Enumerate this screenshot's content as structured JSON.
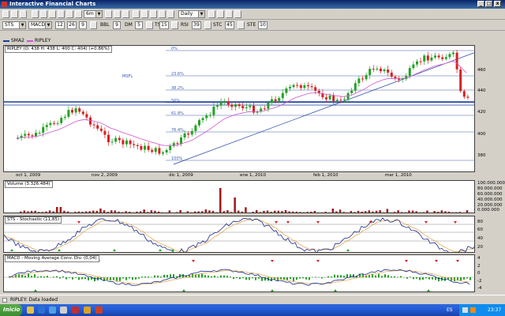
{
  "app": {
    "title": "Interactive Financial Charts",
    "status": "RIPLEY: Data loaded"
  },
  "toolbar1": {
    "period_value": "6m",
    "freq_value": "Daily",
    "buttons": [
      "▭",
      "▭",
      "▭",
      "▭",
      "▭",
      "▭",
      "▭",
      "▭",
      "▭",
      "▭",
      "▭",
      "▭",
      "▭",
      "▭",
      "▭",
      "▭",
      "▭",
      "▭",
      "▭",
      "▭"
    ]
  },
  "toolbar2": {
    "symbol": "STS",
    "indicator": "MACD",
    "fields": [
      "12",
      "26",
      "9"
    ],
    "lbl_bbl": "BBL",
    "val_bbl": "9",
    "lbl_dm": "DM",
    "val_dm": "5",
    "lbl_tsi": "TSI",
    "val_tsi": "15",
    "lbl_rsi": "RSI",
    "val_rsi": "39",
    "lbl_stc": "STC",
    "val_stc": "45",
    "lbl_x": "STE",
    "val_x": "10"
  },
  "legend": {
    "sma": "SMA2",
    "ripley": "RIPLEY",
    "quote": "RIPLEY (O: 438  H: 438  L: 400  C: 404) (+0.86%)"
  },
  "main": {
    "fib_labels": [
      "0%",
      "23.6%",
      "38.2%",
      "50%",
      "61.8%",
      "76.4%",
      "100%"
    ],
    "note": "MSFL",
    "y_labels": [
      "460",
      "440",
      "420",
      "400",
      "380"
    ]
  },
  "dates": [
    "oct 1, 2009",
    "nov 2, 2009",
    "dic 1, 2009",
    "ene 1, 2010",
    "feb 1, 2010",
    "mar 1, 2010"
  ],
  "volume": {
    "title": "Volume (3.326.484)",
    "y_labels": [
      "100.000.000",
      "80.000.000",
      "60.000.000",
      "40.000.000",
      "20.000.000",
      "0.000.000"
    ]
  },
  "sto": {
    "title": "STS - Stochastic (11,85)",
    "y_labels": [
      "80",
      "60",
      "40",
      "20"
    ]
  },
  "macd": {
    "title": "MACD - Moving Average Conv. Div. (0,04)",
    "y_labels": [
      "4",
      "2",
      "0",
      "-2",
      "-4"
    ]
  },
  "taskbar": {
    "start": "Inicio",
    "lang": "ES",
    "time": "23:37"
  },
  "colors": {
    "up": "#22a322",
    "down": "#d82020",
    "sma": "#cc55cc",
    "blue": "#1a3a9a"
  }
}
